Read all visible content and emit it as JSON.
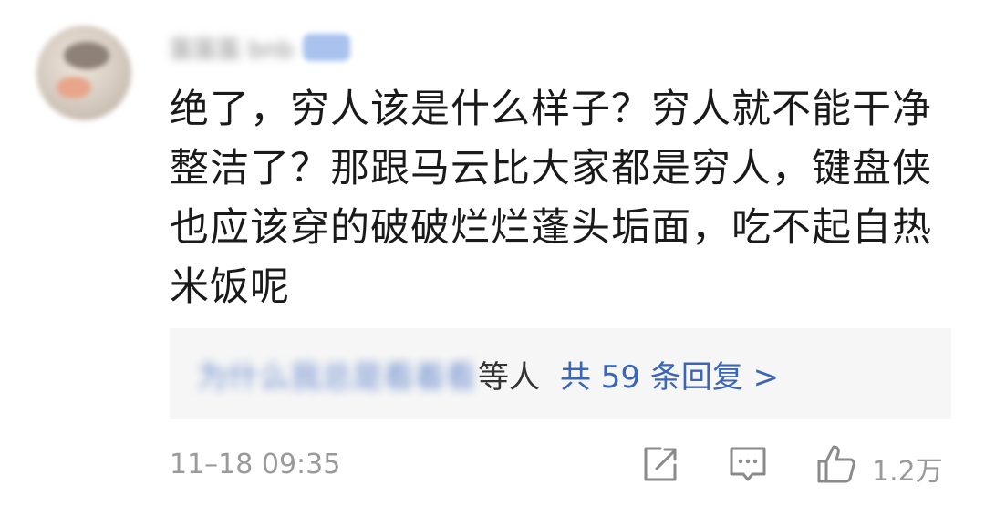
{
  "comment": {
    "username": "笛笛笛 bnb",
    "text": "绝了，穷人该是什么样子？穷人就不能干净整洁了？那跟马云比大家都是穷人，键盘侠也应该穿的破破烂烂蓬头垢面，吃不起自热米饭呢",
    "replies": {
      "names": "为什么我总是看着看",
      "suffix": "等人",
      "count_label": "共 59 条回复 >"
    },
    "timestamp": "11–18 09:35",
    "likes": "1.2万",
    "icons": {
      "share": "share-icon",
      "comment": "comment-icon",
      "like": "thumbs-up-icon"
    },
    "colors": {
      "link": "#3a66b5",
      "text": "#1a1a1a",
      "meta": "#9a9a9a",
      "reply_bg": "#f6f6f6"
    }
  }
}
